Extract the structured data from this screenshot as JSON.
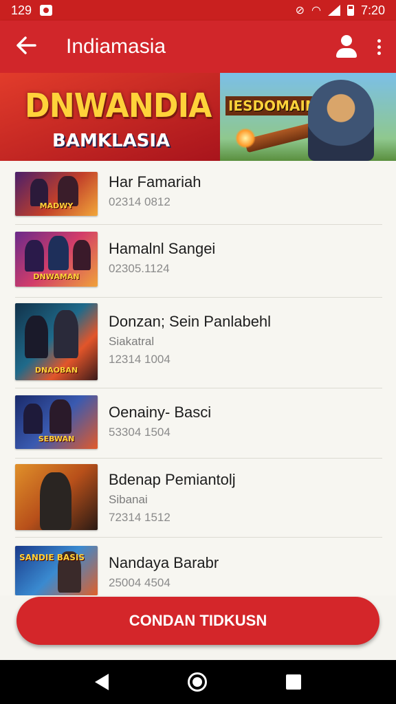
{
  "status_bar": {
    "time_left": "129",
    "time_right": "7:20"
  },
  "app_bar": {
    "title": "Indiamasia"
  },
  "banner": {
    "title": "DNWANDIA",
    "subtitle": "BAMKLASIA",
    "tag": "IESDOMAIN"
  },
  "items": [
    {
      "title": "Har Famariah",
      "subtitle": "",
      "number": "02314 0812",
      "thumb_label": "MADWY"
    },
    {
      "title": "Hamalnl Sangei",
      "subtitle": "",
      "number": "02305.1124",
      "thumb_label": "DNWAMAN"
    },
    {
      "title": "Donzan; Sein Panlabehl",
      "subtitle": "Siakatral",
      "number": "12314 1004",
      "thumb_label": "DNAOBAN"
    },
    {
      "title": "Oenainy- Basci",
      "subtitle": "",
      "number": "53304 1504",
      "thumb_label": "SEBWAN"
    },
    {
      "title": "Bdenap Pemiantolj",
      "subtitle": "Sibanai",
      "number": "72314 1512",
      "thumb_label": ""
    },
    {
      "title": "Nandaya Barabr",
      "subtitle": "",
      "number": "25004 4504",
      "thumb_label": "SANDIE BASIS"
    }
  ],
  "cta": {
    "label": "CONDAN TIDKUSN"
  },
  "colors": {
    "primary": "#d1262a",
    "status": "#c9201f",
    "background": "#f7f6f1"
  },
  "icons": {
    "back": "arrow-left-icon",
    "account": "account-icon",
    "more": "more-vert-icon"
  }
}
